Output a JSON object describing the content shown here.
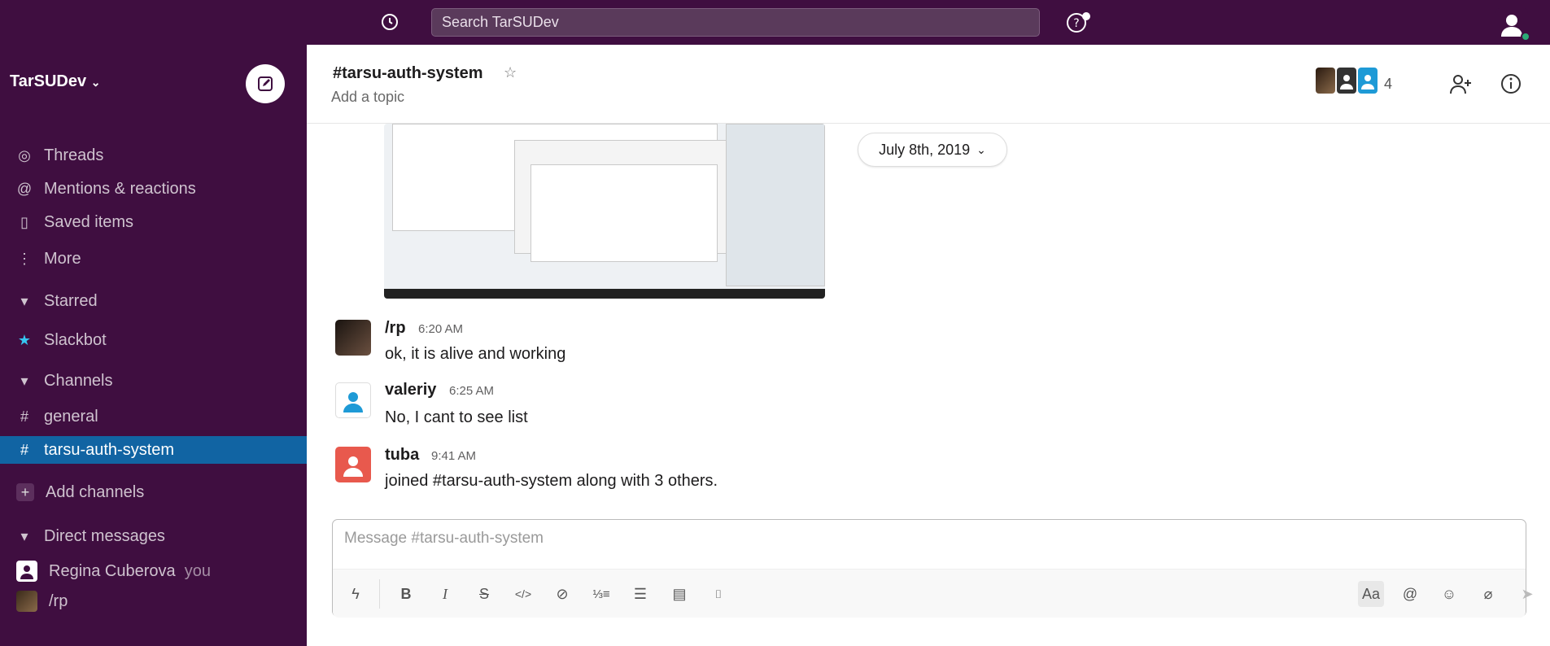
{
  "topbar": {
    "search_placeholder": "Search TarSUDev"
  },
  "sidebar": {
    "workspace": "TarSUDev",
    "items": [
      {
        "icon": "threads-icon",
        "label": "Threads"
      },
      {
        "icon": "at-icon",
        "label": "Mentions & reactions"
      },
      {
        "icon": "bookmark-icon",
        "label": "Saved items"
      },
      {
        "icon": "more-icon",
        "label": "More"
      },
      {
        "icon": "caret-down-icon",
        "label": "Starred"
      },
      {
        "icon": "slackbot-icon",
        "label": "Slackbot"
      },
      {
        "icon": "caret-down-icon",
        "label": "Channels"
      },
      {
        "icon": "hash-icon",
        "label": "general"
      },
      {
        "icon": "hash-icon",
        "label": "tarsu-auth-system"
      },
      {
        "icon": "plus-icon",
        "label": "Add channels"
      },
      {
        "icon": "caret-down-icon",
        "label": "Direct messages"
      }
    ],
    "dms": [
      {
        "name": "Regina Cuberova",
        "suffix": "you"
      },
      {
        "name": "/rp",
        "suffix": ""
      }
    ]
  },
  "channel": {
    "title": "#tarsu-auth-system",
    "topic_placeholder": "Add a topic",
    "member_count": "4"
  },
  "date_divider": "July 8th, 2019",
  "messages": [
    {
      "name": "/rp",
      "time": "6:20 AM",
      "text": "ok, it is alive and working"
    },
    {
      "name": "valeriy",
      "time": "6:25 AM",
      "text": "No, I cant to see list"
    },
    {
      "name": "tuba",
      "time": "9:41 AM",
      "text": "joined #tarsu-auth-system along with 3 others."
    }
  ],
  "composer": {
    "placeholder": "Message #tarsu-auth-system"
  },
  "colors": {
    "sidebar_bg": "#3f0e40",
    "active_item": "#1164a3",
    "presence": "#2bac76"
  }
}
